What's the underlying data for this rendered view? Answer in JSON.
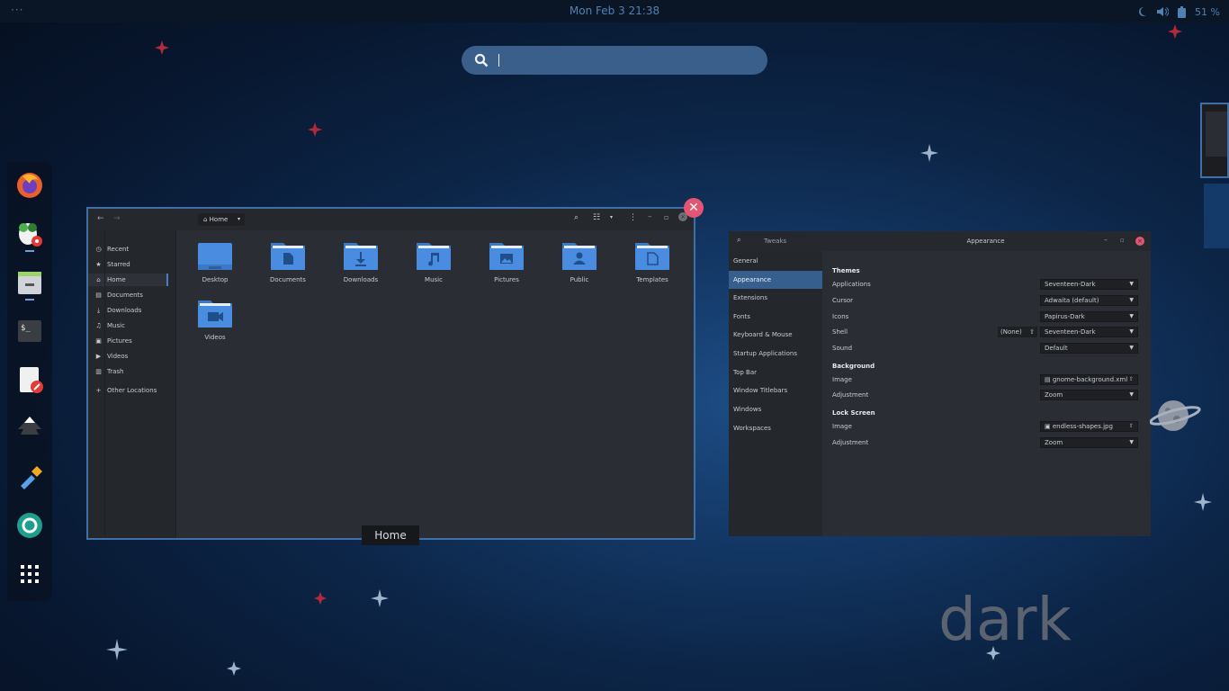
{
  "topbar": {
    "activities_icon": "dots-icon",
    "clock": "Mon Feb 3  21:38",
    "battery": "51 %"
  },
  "search": {
    "placeholder": ""
  },
  "dash": {
    "apps": [
      "firefox-icon",
      "software-icon",
      "files-icon",
      "terminal-icon",
      "text-editor-icon",
      "inkscape-icon",
      "color-picker-icon",
      "screenshot-icon",
      "show-apps-icon"
    ]
  },
  "files": {
    "path": "Home",
    "sidebar": [
      {
        "label": "Recent",
        "icon": "clock-icon"
      },
      {
        "label": "Starred",
        "icon": "star-icon"
      },
      {
        "label": "Home",
        "icon": "home-icon"
      },
      {
        "label": "Documents",
        "icon": "document-icon"
      },
      {
        "label": "Downloads",
        "icon": "download-icon"
      },
      {
        "label": "Music",
        "icon": "music-icon"
      },
      {
        "label": "Pictures",
        "icon": "picture-icon"
      },
      {
        "label": "Videos",
        "icon": "video-icon"
      },
      {
        "label": "Trash",
        "icon": "trash-icon"
      },
      {
        "label": "Other Locations",
        "icon": "plus-icon"
      }
    ],
    "folders": [
      "Desktop",
      "Documents",
      "Downloads",
      "Music",
      "Pictures",
      "Public",
      "Templates",
      "Videos"
    ],
    "caption": "Home"
  },
  "tweaks": {
    "app_title": "Tweaks",
    "page_title": "Appearance",
    "sidebar": [
      "General",
      "Appearance",
      "Extensions",
      "Fonts",
      "Keyboard & Mouse",
      "Startup Applications",
      "Top Bar",
      "Window Titlebars",
      "Windows",
      "Workspaces"
    ],
    "themes_heading": "Themes",
    "applications_label": "Applications",
    "applications_value": "Seventeen-Dark",
    "cursor_label": "Cursor",
    "cursor_value": "Adwaita (default)",
    "icons_label": "Icons",
    "icons_value": "Papirus-Dark",
    "shell_label": "Shell",
    "shell_none": "(None)",
    "shell_value": "Seventeen-Dark",
    "sound_label": "Sound",
    "sound_value": "Default",
    "background_heading": "Background",
    "bg_image_label": "Image",
    "bg_image_value": "gnome-background.xml",
    "bg_adjust_label": "Adjustment",
    "bg_adjust_value": "Zoom",
    "lock_heading": "Lock Screen",
    "lock_image_label": "Image",
    "lock_image_value": "endless-shapes.jpg",
    "lock_adjust_label": "Adjustment",
    "lock_adjust_value": "Zoom"
  },
  "wallpaper_text": "dark"
}
